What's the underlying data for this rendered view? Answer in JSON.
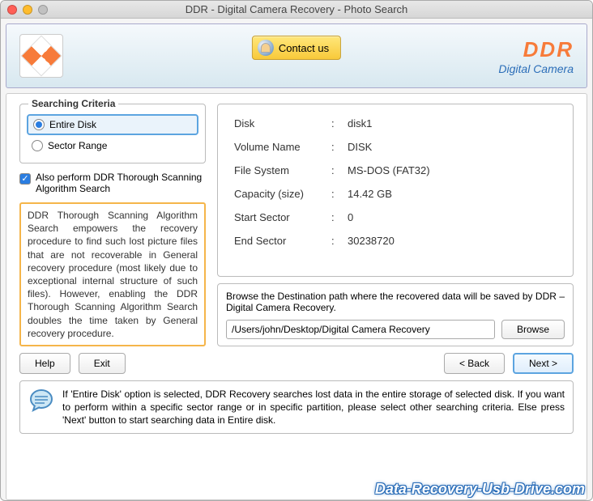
{
  "window": {
    "title": "DDR - Digital Camera Recovery - Photo Search"
  },
  "header": {
    "contact_label": "Contact us",
    "brand": "DDR",
    "brand_sub": "Digital Camera"
  },
  "criteria": {
    "legend": "Searching Criteria",
    "options": [
      {
        "label": "Entire Disk",
        "selected": true
      },
      {
        "label": "Sector Range",
        "selected": false
      }
    ],
    "thorough_label": "Also perform DDR Thorough Scanning Algorithm Search",
    "thorough_checked": true
  },
  "description": "DDR Thorough Scanning Algorithm Search empowers the recovery procedure to find such lost picture files that are not recoverable in General recovery procedure (most likely due to exceptional internal structure of such files). However, enabling the DDR Thorough Scanning Algorithm Search doubles the time taken by General recovery procedure.",
  "disk_info": {
    "rows": [
      {
        "label": "Disk",
        "value": "disk1"
      },
      {
        "label": "Volume Name",
        "value": "DISK"
      },
      {
        "label": "File System",
        "value": "MS-DOS (FAT32)"
      },
      {
        "label": "Capacity (size)",
        "value": "14.42  GB"
      },
      {
        "label": "Start Sector",
        "value": "0"
      },
      {
        "label": "End Sector",
        "value": "30238720"
      }
    ]
  },
  "destination": {
    "text": "Browse the Destination path where the recovered data will be saved by DDR – Digital Camera Recovery.",
    "path": "/Users/john/Desktop/Digital Camera Recovery",
    "browse_label": "Browse"
  },
  "buttons": {
    "help": "Help",
    "exit": "Exit",
    "back": "< Back",
    "next": "Next >"
  },
  "hint": "If 'Entire Disk' option is selected, DDR Recovery searches lost data in the entire storage of selected disk. If you want to perform within a specific sector range or in specific partition, please select other searching criteria. Else press 'Next' button to start searching data in Entire disk.",
  "watermark": "Data-Recovery-Usb-Drive.com"
}
